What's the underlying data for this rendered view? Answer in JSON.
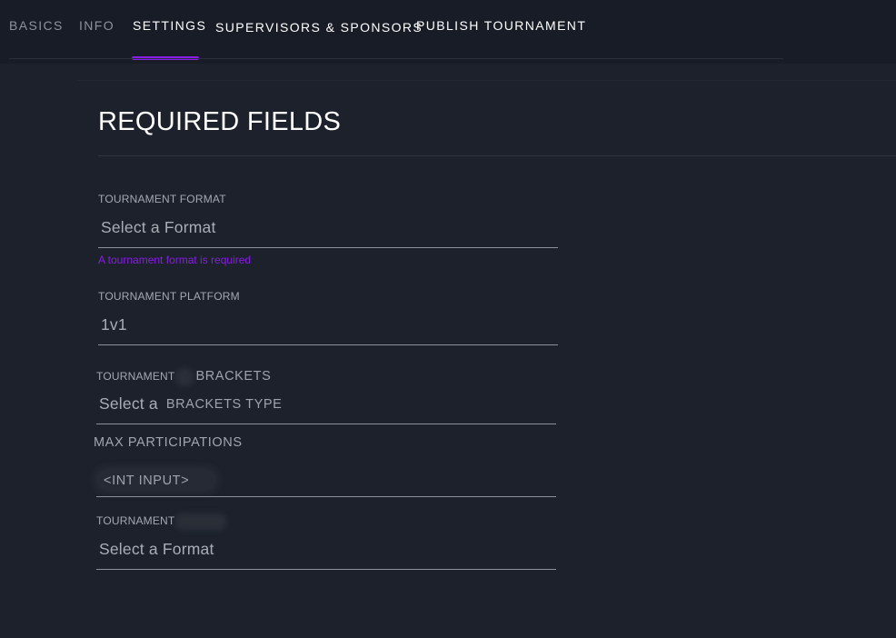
{
  "nav": {
    "tabs": [
      {
        "label": "BASICS",
        "active": false
      },
      {
        "label": "INFO",
        "active": false
      },
      {
        "label": "SETTINGS",
        "active": true
      },
      {
        "label": "SUPERVISORS & SPONSORS",
        "active": false
      },
      {
        "label": "PUBLISH TOURNAMENT",
        "active": false
      }
    ]
  },
  "section": {
    "title": "REQUIRED FIELDS"
  },
  "fields": {
    "format": {
      "label": "TOURNAMENT FORMAT",
      "placeholder": "Select a Format",
      "error": "A tournament format is required"
    },
    "platform": {
      "label": "TOURNAMENT PLATFORM",
      "value": "1v1"
    },
    "brackets": {
      "label_prefix": "TOURNAMENT",
      "label_suffix": "BRACKETS",
      "placeholder_prefix": "Select a",
      "placeholder_suffix": "BRACKETS TYPE"
    },
    "max_participations": {
      "label": "MAX PARTICIPATIONS",
      "value": "<INT INPUT>"
    },
    "extra": {
      "label_prefix": "TOURNAMENT",
      "placeholder": "Select a Format"
    }
  },
  "colors": {
    "background": "#1c212b",
    "topbar": "#181c26",
    "accent": "#8a1ce8",
    "text_primary": "#ffffff",
    "text_muted": "#8d929c"
  }
}
